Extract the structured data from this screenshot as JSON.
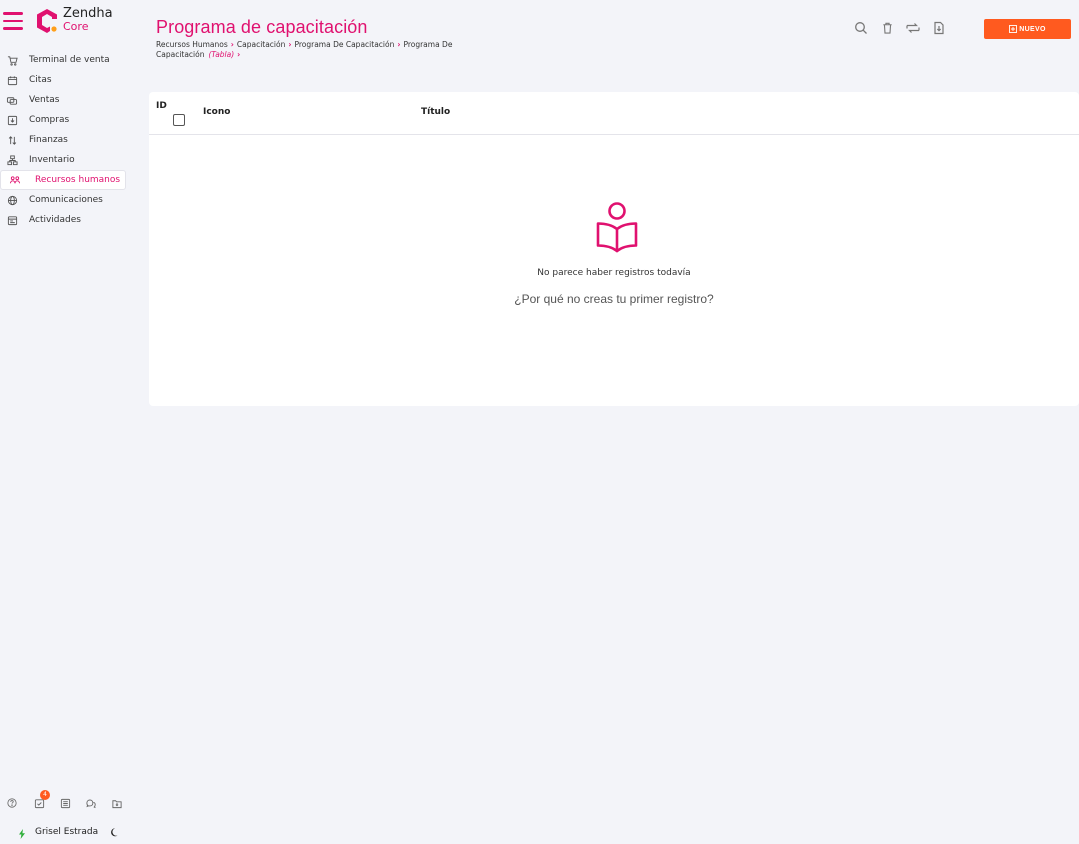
{
  "brand": {
    "name": "Zendha",
    "sub": "Core"
  },
  "colors": {
    "accent": "#e0116f",
    "primary_button": "#ff5a1f",
    "background": "#f3f4f9"
  },
  "nav": {
    "items": [
      {
        "label": "Terminal de venta",
        "icon": "cart-icon"
      },
      {
        "label": "Citas",
        "icon": "calendar-icon"
      },
      {
        "label": "Ventas",
        "icon": "money-icon"
      },
      {
        "label": "Compras",
        "icon": "download-box-icon"
      },
      {
        "label": "Finanzas",
        "icon": "arrows-updown-icon"
      },
      {
        "label": "Inventario",
        "icon": "boxes-icon"
      },
      {
        "label": "Recursos humanos",
        "icon": "people-icon",
        "active": true
      },
      {
        "label": "Comunicaciones",
        "icon": "globe-icon"
      },
      {
        "label": "Actividades",
        "icon": "calendar-list-icon"
      }
    ]
  },
  "footer": {
    "badge_count": "4",
    "user_name": "Grisel Estrada"
  },
  "header": {
    "title": "Programa de capacitación",
    "breadcrumb": [
      "Recursos Humanos",
      "Capacitación",
      "Programa De Capacitación",
      "Programa De Capacitación"
    ],
    "view": "(Tabla)",
    "new_label": "NUEVO"
  },
  "table": {
    "columns": {
      "id": "ID",
      "icon": "Icono",
      "title": "Título"
    }
  },
  "empty": {
    "message": "No parece haber registros todavía",
    "cta": "¿Por qué no creas tu primer registro?"
  }
}
